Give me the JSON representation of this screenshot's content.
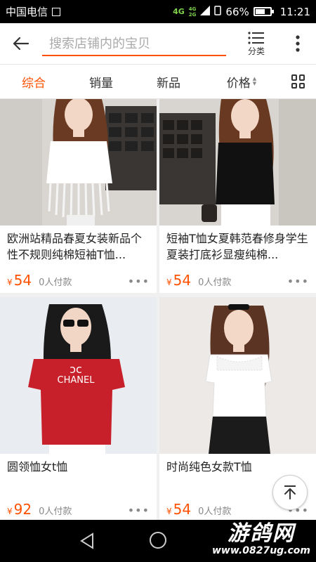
{
  "status_bar": {
    "carrier": "中国电信",
    "net_type": "4G",
    "net_type_small_top": "4G",
    "net_type_small_bottom": "2G",
    "battery_percent": "66%",
    "battery_level": 0.66,
    "time": "11:21"
  },
  "header": {
    "search_placeholder": "搜索店铺内的宝贝",
    "category_label": "分类"
  },
  "sort_bar": {
    "tabs": [
      {
        "label": "综合",
        "active": true
      },
      {
        "label": "销量",
        "active": false
      },
      {
        "label": "新品",
        "active": false
      },
      {
        "label": "价格",
        "active": false
      }
    ]
  },
  "products": [
    {
      "title": "欧洲站精品春夏女装新品个性不规则纯棉短袖T恤...",
      "currency": "¥",
      "price": "54",
      "sold": "0人付款",
      "shirt_color": "#ffffff",
      "more": "•••"
    },
    {
      "title": "短袖T恤女夏韩范春修身学生夏装打底衫显瘦纯棉...",
      "currency": "¥",
      "price": "54",
      "sold": "0人付款",
      "shirt_color": "#111111",
      "more": "•••"
    },
    {
      "title": "圆领恤女t恤",
      "currency": "¥",
      "price": "92",
      "sold": "0人付款",
      "shirt_color": "#c8202a",
      "shirt_text": "CHANEL",
      "more": "•••"
    },
    {
      "title": "时尚纯色女款T恤",
      "currency": "¥",
      "price": "54",
      "sold": "0人付款",
      "shirt_color": "#ffffff",
      "more": "•••"
    }
  ],
  "watermark": {
    "title": "游鸽网",
    "url": "www.0827ug.com"
  },
  "colors": {
    "accent": "#ff5000",
    "status_bar_bg": "#000000",
    "nav_bar_bg": "#000000"
  }
}
